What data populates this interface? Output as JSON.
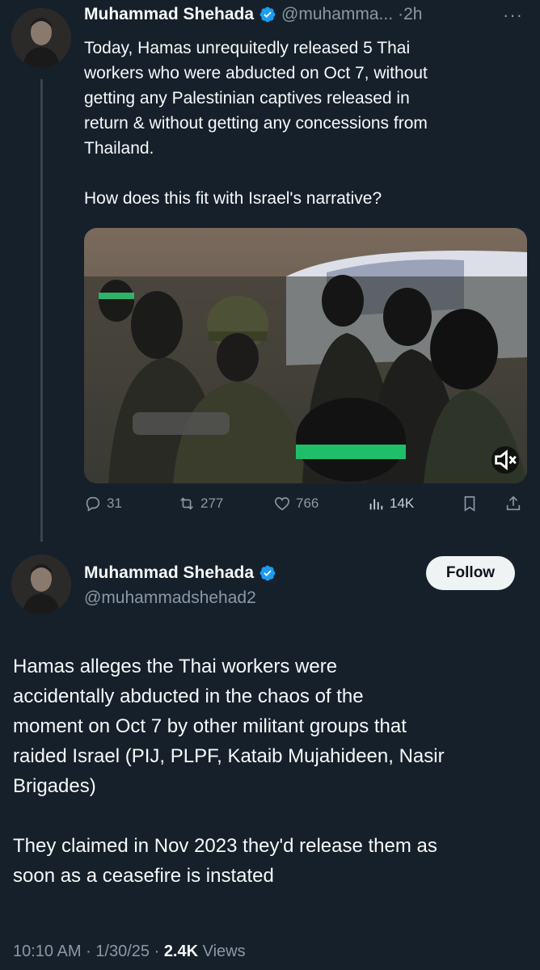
{
  "tweet1": {
    "author_name": "Muhammad Shehada",
    "author_handle": "@muhamma...",
    "time": "·2h",
    "more": "···",
    "text_lines": [
      "Today, Hamas unrequitedly released 5 Thai",
      "workers who were abducted on Oct 7, without",
      "getting any Palestinian captives released in",
      "return & without getting any concessions from",
      "Thailand."
    ],
    "text_line2": "How does this fit with Israel's narrative?",
    "media": {
      "mute_icon": "speaker-mute-icon"
    },
    "actions": {
      "replies": "31",
      "reposts": "277",
      "likes": "766",
      "views": "14K"
    }
  },
  "tweet2": {
    "author_name": "Muhammad Shehada",
    "author_handle": "@muhammadshehad2",
    "follow_label": "Follow",
    "paragraph1_lines": [
      "Hamas alleges the Thai workers were",
      "accidentally abducted in the chaos of the",
      "moment on Oct 7 by other militant groups that",
      "raided Israel (PIJ, PLPF, Kataib Mujahideen, Nasir",
      "Brigades)"
    ],
    "paragraph2_lines": [
      "They claimed in Nov 2023 they'd release them as",
      "soon as a ceasefire is instated"
    ],
    "meta": {
      "time": "10:10 AM",
      "date": "1/30/25",
      "views_count": "2.4K",
      "views_label": "Views"
    }
  },
  "colors": {
    "background": "#15202b",
    "text": "#f7f9f9",
    "secondary_text": "#8b98a5",
    "verified": "#1d9bf0",
    "thread_line": "#38444d"
  }
}
